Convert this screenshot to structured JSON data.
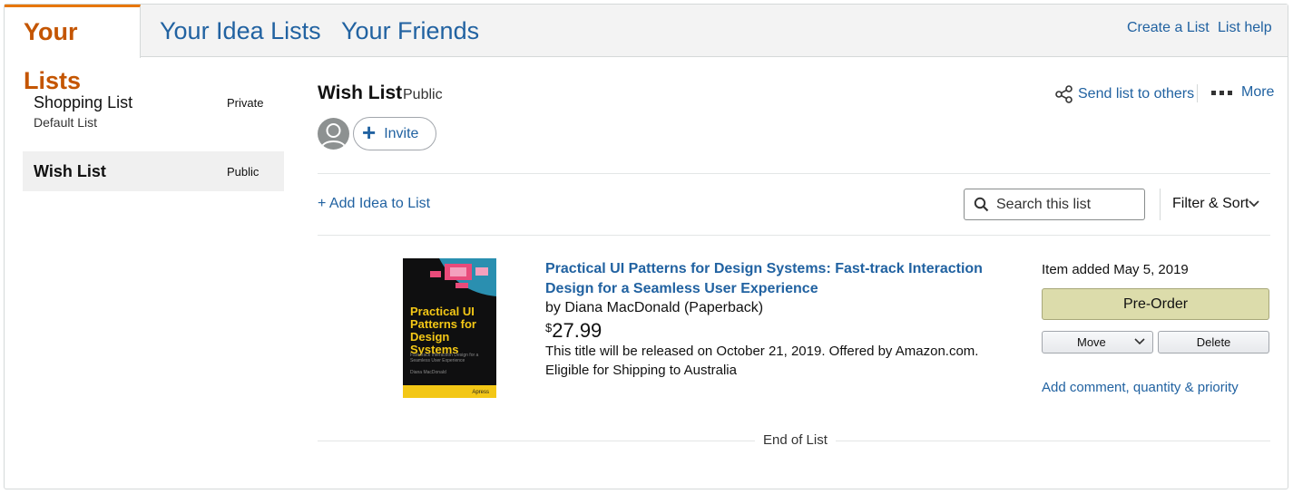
{
  "tabs": [
    {
      "label": "Your Lists",
      "active": true
    },
    {
      "label": "Your Idea Lists",
      "active": false
    },
    {
      "label": "Your Friends",
      "active": false
    }
  ],
  "header_links": {
    "create": "Create a List",
    "help": "List help"
  },
  "lists": [
    {
      "name": "Shopping List",
      "sub": "Default List",
      "privacy": "Private",
      "selected": false
    },
    {
      "name": "Wish List",
      "sub": "",
      "privacy": "Public",
      "selected": true
    }
  ],
  "main": {
    "title": "Wish List",
    "status": "Public",
    "send_label": "Send list to others",
    "more_label": "More",
    "invite_label": "Invite",
    "add_idea_label": "+ Add Idea to List",
    "search_placeholder": "Search this list",
    "filter_label": "Filter & Sort"
  },
  "item": {
    "title": "Practical UI Patterns for Design Systems: Fast-track Interaction Design for a Seamless User Experience",
    "byline": "by Diana MacDonald (Paperback)",
    "currency": "$",
    "price": "27.99",
    "note_line1": "This title will be released on October 21, 2019.  Offered by Amazon.com.",
    "note_line2": "Eligible for Shipping to Australia",
    "added": "Item added May 5, 2019",
    "preorder_label": "Pre-Order",
    "move_label": "Move",
    "delete_label": "Delete",
    "comment_label": "Add comment, quantity & priority",
    "cover": {
      "title": "Practical UI Patterns for Design Systems",
      "subtitle": "Fast-track Interaction Design for a Seamless User Experience",
      "author": "Diana MacDonald",
      "publisher": "Apress"
    }
  },
  "footer": {
    "end_label": "End of List"
  },
  "colors": {
    "link": "#2162a1",
    "active_tab": "#c45500",
    "tab_accent": "#e77600",
    "preorder_bg": "#dcdcab"
  }
}
